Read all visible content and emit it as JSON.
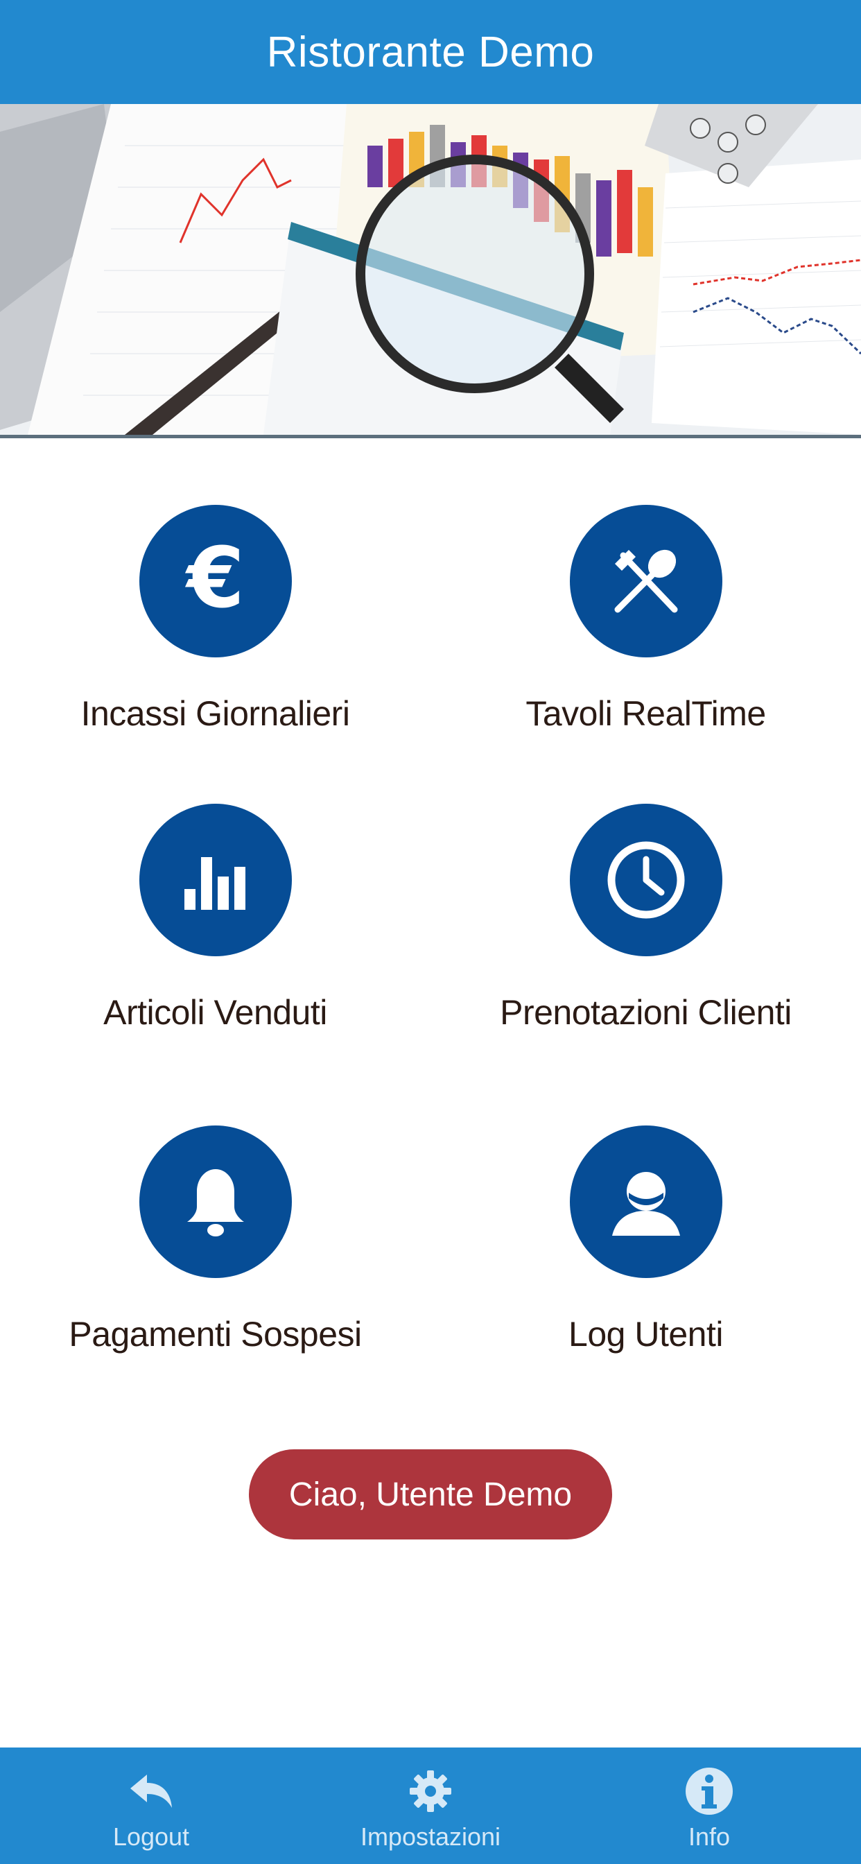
{
  "header": {
    "title": "Ristorante Demo"
  },
  "menu": {
    "items": [
      {
        "label": "Incassi Giornalieri",
        "icon": "euro-icon"
      },
      {
        "label": "Tavoli RealTime",
        "icon": "cutlery-icon"
      },
      {
        "label": "Articoli Venduti",
        "icon": "bar-chart-icon"
      },
      {
        "label": "Prenotazioni Clienti",
        "icon": "clock-icon"
      },
      {
        "label": "Pagamenti Sospesi",
        "icon": "bell-icon"
      },
      {
        "label": "Log Utenti",
        "icon": "user-icon"
      }
    ]
  },
  "greeting": {
    "text": "Ciao, Utente Demo"
  },
  "tabbar": {
    "items": [
      {
        "label": "Logout",
        "icon": "reply-icon"
      },
      {
        "label": "Impostazioni",
        "icon": "gear-icon"
      },
      {
        "label": "Info",
        "icon": "info-icon"
      }
    ]
  },
  "colors": {
    "primary": "#2289cf",
    "icon_circle": "#064d96",
    "greeting_bg": "#ad353d",
    "label_text": "#2a1a14"
  }
}
